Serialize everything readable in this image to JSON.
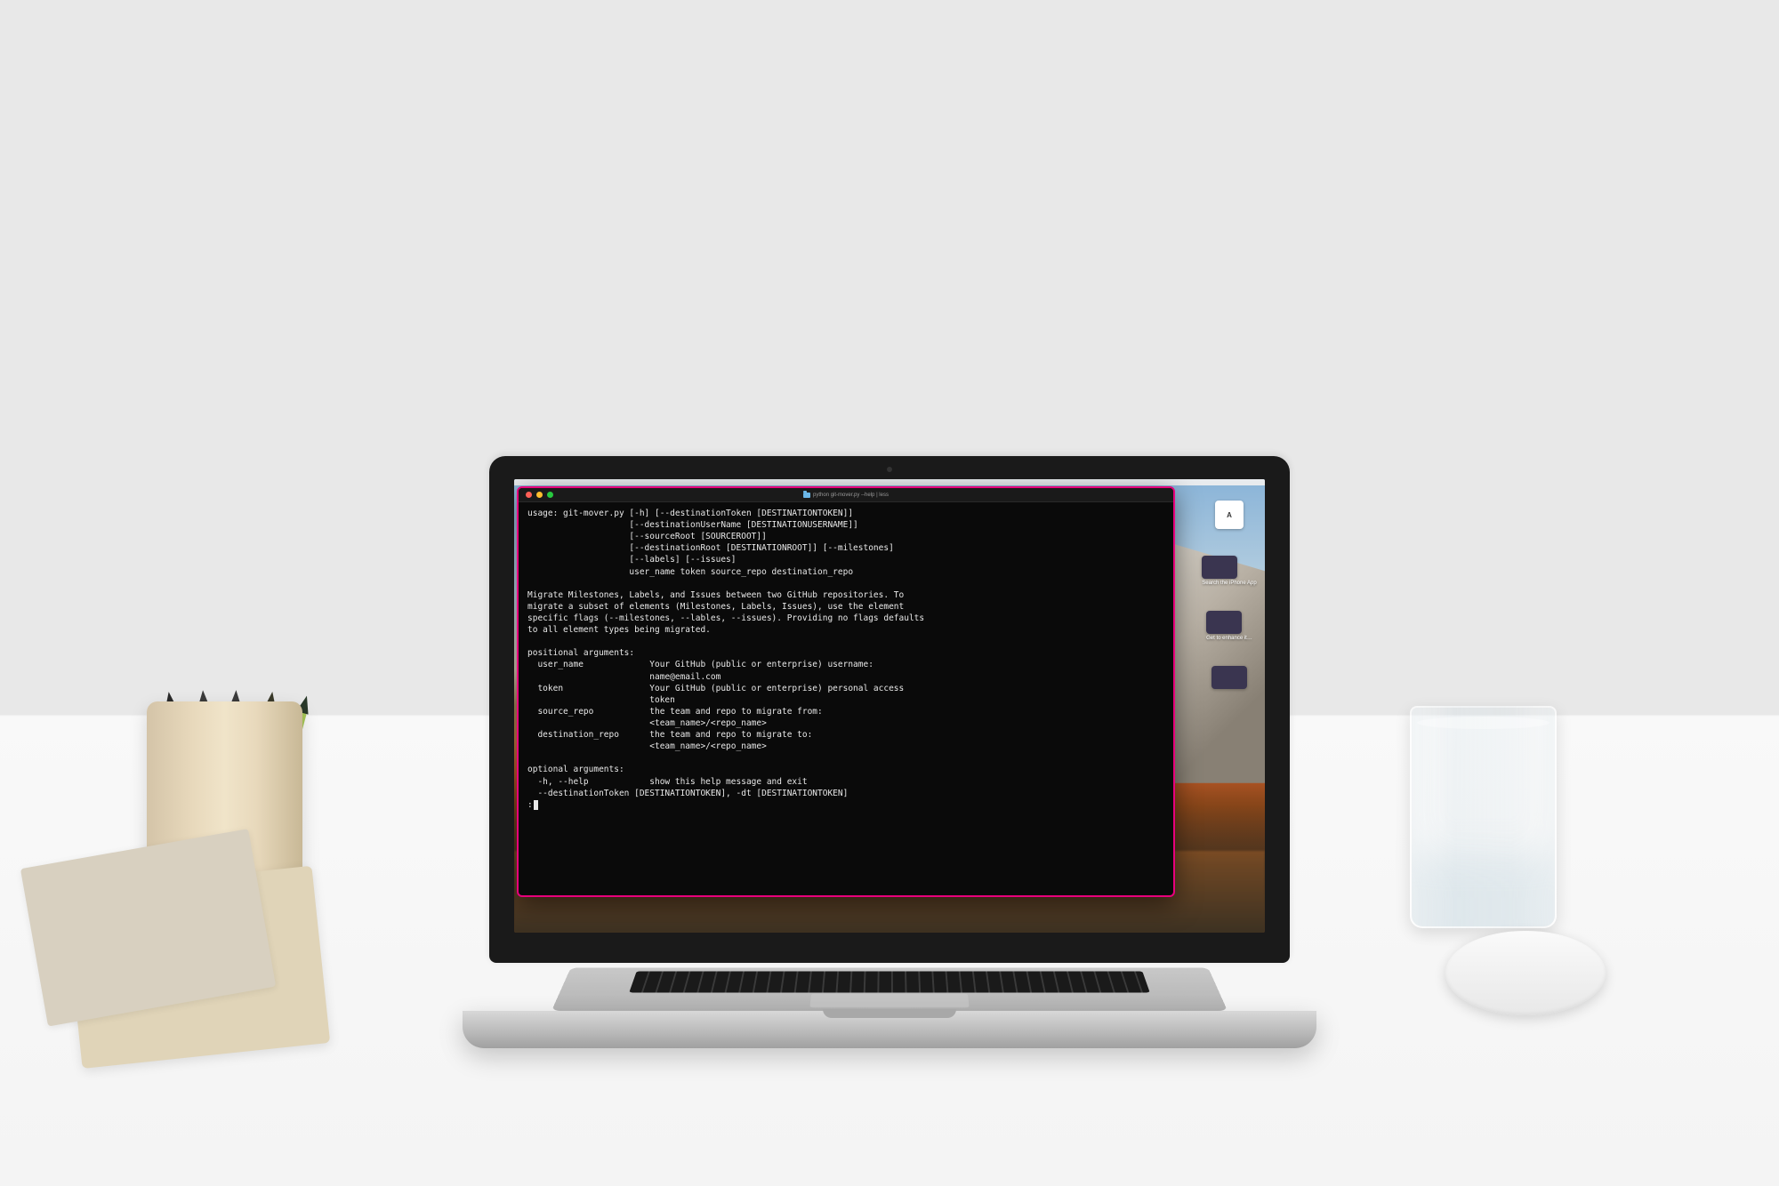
{
  "terminal": {
    "title": "python git-mover.py --help | less",
    "lines": [
      "usage: git-mover.py [-h] [--destinationToken [DESTINATIONTOKEN]]",
      "                    [--destinationUserName [DESTINATIONUSERNAME]]",
      "                    [--sourceRoot [SOURCEROOT]]",
      "                    [--destinationRoot [DESTINATIONROOT]] [--milestones]",
      "                    [--labels] [--issues]",
      "                    user_name token source_repo destination_repo",
      "",
      "Migrate Milestones, Labels, and Issues between two GitHub repositories. To",
      "migrate a subset of elements (Milestones, Labels, Issues), use the element",
      "specific flags (--milestones, --lables, --issues). Providing no flags defaults",
      "to all element types being migrated.",
      "",
      "positional arguments:",
      "  user_name             Your GitHub (public or enterprise) username:",
      "                        name@email.com",
      "  token                 Your GitHub (public or enterprise) personal access",
      "                        token",
      "  source_repo           the team and repo to migrate from:",
      "                        <team_name>/<repo_name>",
      "  destination_repo      the team and repo to migrate to:",
      "                        <team_name>/<repo_name>",
      "",
      "optional arguments:",
      "  -h, --help            show this help message and exit",
      "  --destinationToken [DESTINATIONTOKEN], -dt [DESTINATIONTOKEN]"
    ],
    "prompt": ":"
  },
  "desktop": {
    "icons": [
      {
        "glyph": "A",
        "label": ""
      },
      {
        "glyph": "",
        "label": "Search the iPhone App"
      },
      {
        "glyph": "",
        "label": "Get to enhance it…"
      },
      {
        "glyph": "",
        "label": ""
      }
    ]
  },
  "colors": {
    "terminal_border": "#e8007c",
    "terminal_bg": "#0a0a0a",
    "terminal_fg": "#e8e8e8"
  }
}
